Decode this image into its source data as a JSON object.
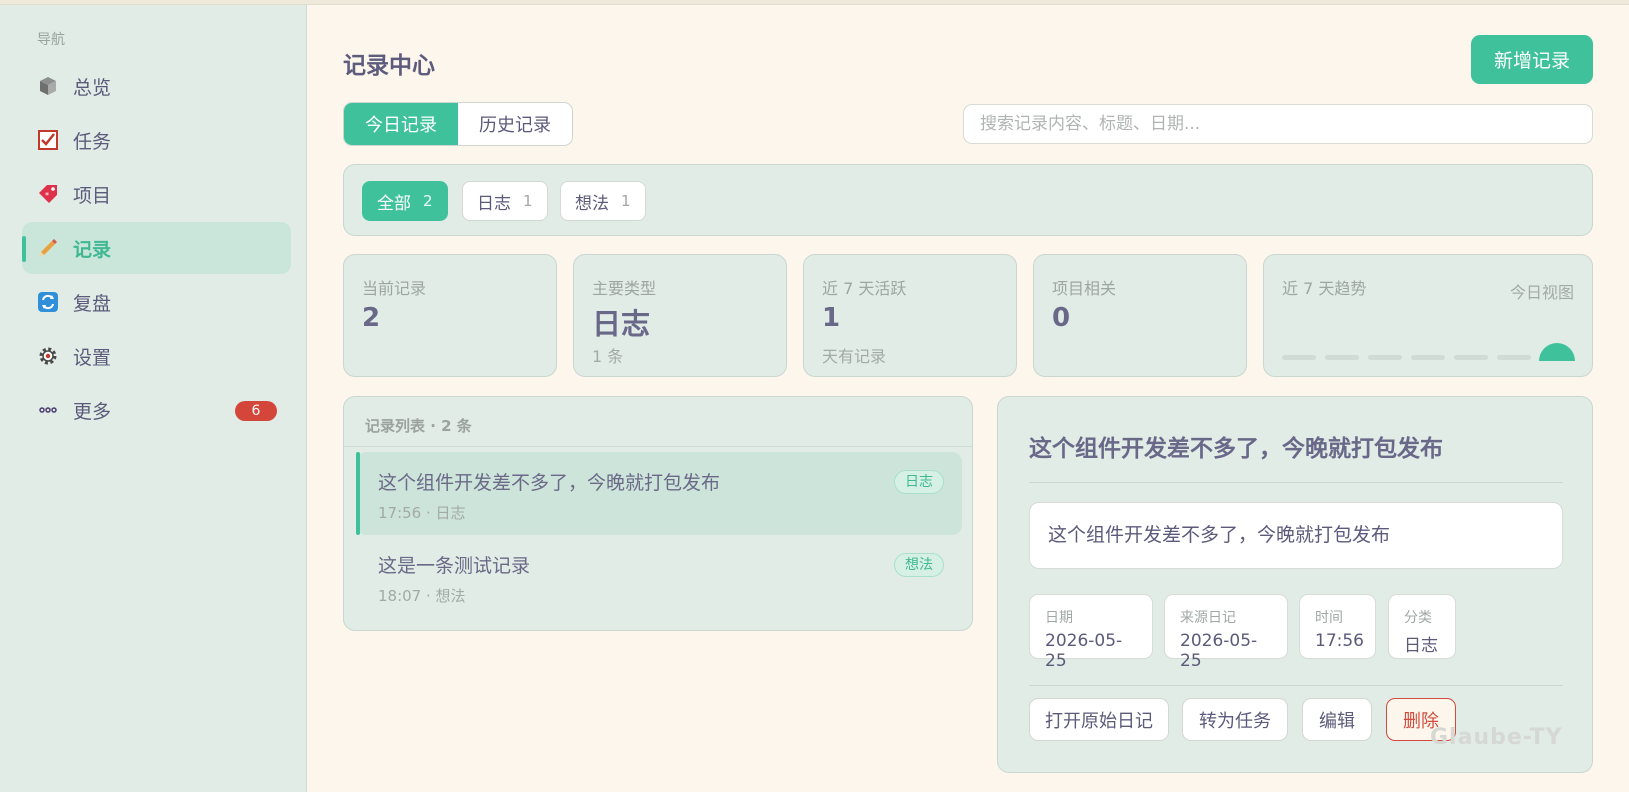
{
  "sidebar": {
    "heading": "导航",
    "items": [
      {
        "label": "总览",
        "icon": "cube-icon"
      },
      {
        "label": "任务",
        "icon": "checkbox-icon"
      },
      {
        "label": "项目",
        "icon": "tag-icon"
      },
      {
        "label": "记录",
        "icon": "pencil-icon",
        "active": true
      },
      {
        "label": "复盘",
        "icon": "refresh-icon"
      },
      {
        "label": "设置",
        "icon": "gear-icon"
      },
      {
        "label": "更多",
        "icon": "more-icon",
        "badge": "6"
      }
    ]
  },
  "header": {
    "title": "记录中心",
    "new_button": "新增记录"
  },
  "tabs": [
    "今日记录",
    "历史记录"
  ],
  "search": {
    "placeholder": "搜索记录内容、标题、日期..."
  },
  "filters": [
    {
      "label": "全部",
      "count": "2",
      "active": true
    },
    {
      "label": "日志",
      "count": "1"
    },
    {
      "label": "想法",
      "count": "1"
    }
  ],
  "stats": {
    "current": {
      "label": "当前记录",
      "value": "2"
    },
    "main_type": {
      "label": "主要类型",
      "value": "日志",
      "sub": "1 条"
    },
    "active7": {
      "label": "近 7 天活跃",
      "value": "1",
      "sub": "天有记录"
    },
    "project": {
      "label": "项目相关",
      "value": "0"
    },
    "trend": {
      "label": "近 7 天趋势",
      "right": "今日视图",
      "levels": [
        0,
        0,
        0,
        0,
        0,
        0,
        1
      ]
    }
  },
  "list": {
    "header": "记录列表 · 2 条",
    "items": [
      {
        "title": "这个组件开发差不多了，今晚就打包发布",
        "meta": "17:56 · 日志",
        "tag": "日志",
        "active": true
      },
      {
        "title": "这是一条测试记录",
        "meta": "18:07 · 想法",
        "tag": "想法"
      }
    ]
  },
  "detail": {
    "title": "这个组件开发差不多了，今晚就打包发布",
    "content": "这个组件开发差不多了，今晚就打包发布",
    "meta": {
      "date": {
        "k": "日期",
        "v": "2026-05-25"
      },
      "source": {
        "k": "来源日记",
        "v": "2026-05-25"
      },
      "time": {
        "k": "时间",
        "v": "17:56"
      },
      "category": {
        "k": "分类",
        "v": "日志"
      }
    },
    "actions": {
      "open": "打开原始日记",
      "to_task": "转为任务",
      "edit": "编辑",
      "delete": "删除"
    }
  },
  "watermark": "Glaube-TY",
  "colors": {
    "accent": "#3fc29c",
    "danger": "#d14b3e",
    "badge": "#d5463a"
  }
}
